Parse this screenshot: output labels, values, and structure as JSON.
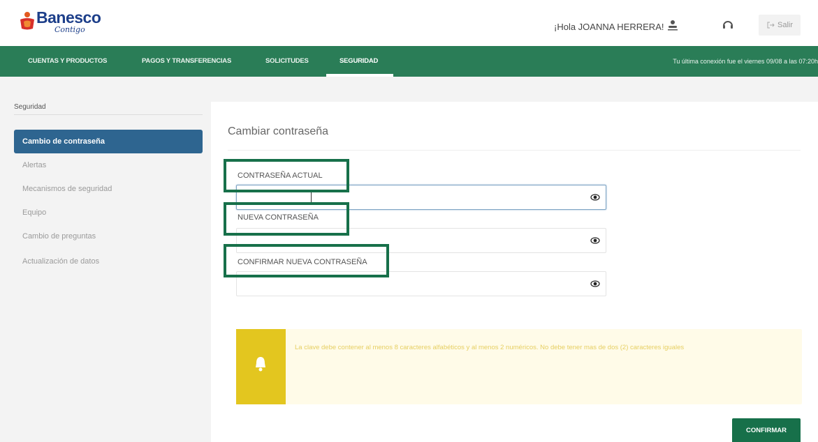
{
  "header": {
    "logo_text": "Banesco",
    "logo_sub": "Contigo",
    "greeting": "¡Hola JOANNA HERRERA!",
    "logout_label": "Salir"
  },
  "nav": {
    "items": [
      {
        "label": "CUENTAS Y PRODUCTOS",
        "active": false
      },
      {
        "label": "PAGOS Y TRANSFERENCIAS",
        "active": false
      },
      {
        "label": "SOLICITUDES",
        "active": false
      },
      {
        "label": "SEGURIDAD",
        "active": true
      }
    ],
    "last_connection": "Tu última conexión fue el viernes 09/08 a las 07:20h"
  },
  "sidebar": {
    "title": "Seguridad",
    "items": [
      {
        "label": "Cambio de contraseña",
        "active": true
      },
      {
        "label": "Alertas",
        "active": false
      },
      {
        "label": "Mecanismos de seguridad",
        "active": false
      },
      {
        "label": "Equipo",
        "active": false
      },
      {
        "label": "Cambio de preguntas",
        "active": false
      },
      {
        "label": "Actualización de datos",
        "active": false
      }
    ]
  },
  "form": {
    "title": "Cambiar contraseña",
    "current_label": "CONTRASEÑA ACTUAL",
    "new_label": "NUEVA CONTRASEÑA",
    "confirm_label": "CONFIRMAR NUEVA CONTRASEÑA",
    "current_value": "",
    "new_value": "",
    "confirm_value": ""
  },
  "notice": {
    "text": "La clave debe contener al menos 8 caracteres alfabéticos y al menos 2 numéricos. No debe tener mas de dos (2) caracteres iguales"
  },
  "confirm_button": "CONFIRMAR",
  "colors": {
    "brand_green": "#2a7d57",
    "highlight_green": "#17704a",
    "sidebar_active": "#2e6590",
    "notice_yellow": "#e3c61f"
  },
  "icons": [
    "user-icon",
    "headset-icon",
    "logout-icon",
    "eye-icon",
    "bell-icon"
  ]
}
